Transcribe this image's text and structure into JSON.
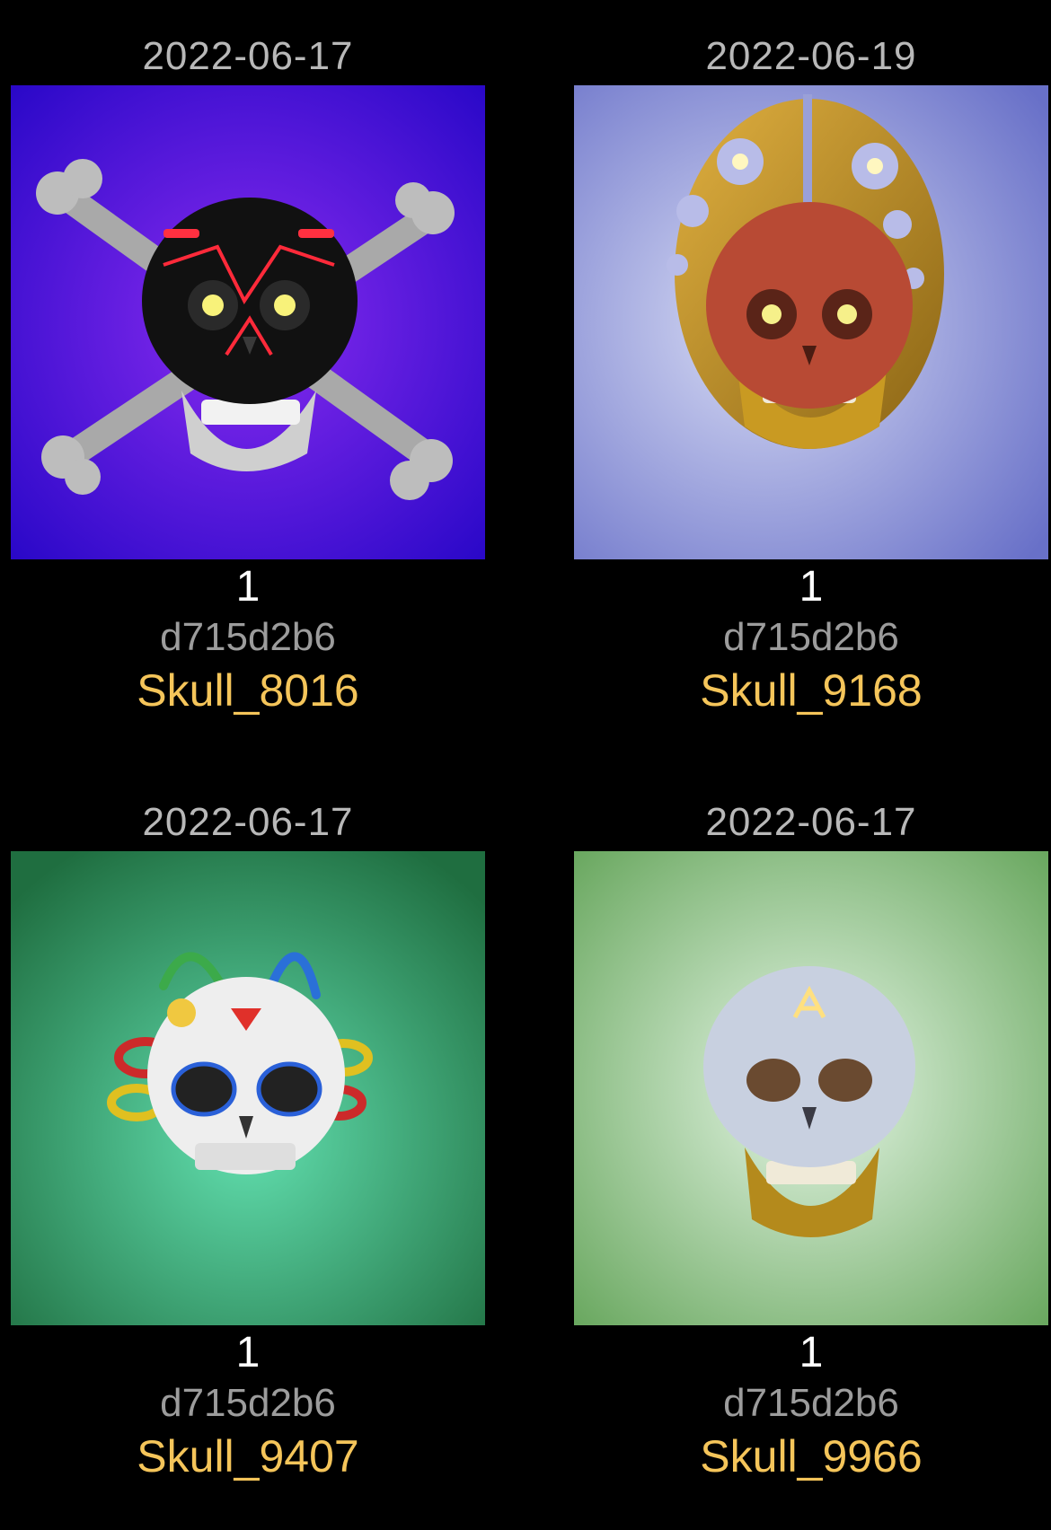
{
  "theme": {
    "background": "#000000",
    "date_color": "#b8b8b8",
    "count_color": "#ffffff",
    "hash_color": "#9c9c9c",
    "name_color": "#f5c55a"
  },
  "items": [
    {
      "date": "2022-06-17",
      "count": "1",
      "hash": "d715d2b6",
      "name": "Skull_8016",
      "image": "skull-crossbones-red-neon-icon",
      "background": "#4a10e0"
    },
    {
      "date": "2022-06-19",
      "count": "1",
      "hash": "d715d2b6",
      "name": "Skull_9168",
      "image": "skull-red-gold-halo-icon",
      "background": "#8f95d8"
    },
    {
      "date": "2022-06-17",
      "count": "1",
      "hash": "d715d2b6",
      "name": "Skull_9407",
      "image": "sugar-skull-rings-icon",
      "background": "#2fae78"
    },
    {
      "date": "2022-06-17",
      "count": "1",
      "hash": "d715d2b6",
      "name": "Skull_9966",
      "image": "silver-skull-gold-jaw-icon",
      "background": "#a8dca8"
    }
  ]
}
